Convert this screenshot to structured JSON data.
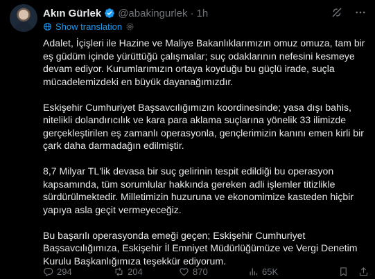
{
  "author": {
    "name": "Akın Gürlek",
    "handle": "@abakingurlek",
    "separator": "·",
    "time": "1h"
  },
  "translation": {
    "label": "Show translation"
  },
  "body": {
    "paragraphs": [
      "Adalet, İçişleri ile Hazine ve Maliye Bakanlıklarımızın omuz omuza, tam bir eş güdüm içinde yürüttüğü çalışmalar; suç odaklarının nefesini kesmeye devam ediyor. Kurumlarımızın ortaya koyduğu bu güçlü irade, suçla mücadelemizdeki en büyük dayanağımızdır.",
      "Eskişehir Cumhuriyet Başsavcılığımızın koordinesinde; yasa dışı bahis, nitelikli dolandırıcılık ve kara para aklama suçlarına yönelik 33 ilimizde gerçekleştirilen eş zamanlı operasyonla, gençlerimizin kanını emen kirli bir çark daha darmadağın edilmiştir.",
      "8,7 Milyar TL'lik devasa bir suç gelirinin tespit edildiği bu operasyon kapsamında, tüm sorumlular hakkında gereken adli işlemler titizlikle sürdürülmektedir. Milletimizin huzuruna ve ekonomimize kasteden hiçbir yapıya asla geçit vermeyeceğiz.",
      "Bu başarılı operasyonda emeği geçen; Eskişehir Cumhuriyet Başsavcılığımıza, Eskişehir İl Emniyet Müdürlüğümüze ve Vergi Denetim Kurulu Başkanlığımıza teşekkür ediyorum."
    ]
  },
  "metrics": {
    "replies": "294",
    "reposts": "204",
    "likes": "870",
    "views": "65K"
  },
  "colors": {
    "background": "#000000",
    "text": "#e7e9ea",
    "muted": "#71767b",
    "accent": "#1d9bf0"
  },
  "icons": {
    "verified": "verified-badge-icon",
    "grok": "grok-icon",
    "more": "more-icon",
    "globe": "globe-icon",
    "settings": "gear-icon",
    "reply": "reply-icon",
    "repost": "repost-icon",
    "like": "heart-icon",
    "views": "views-icon",
    "bookmark": "bookmark-icon",
    "share": "share-icon"
  }
}
